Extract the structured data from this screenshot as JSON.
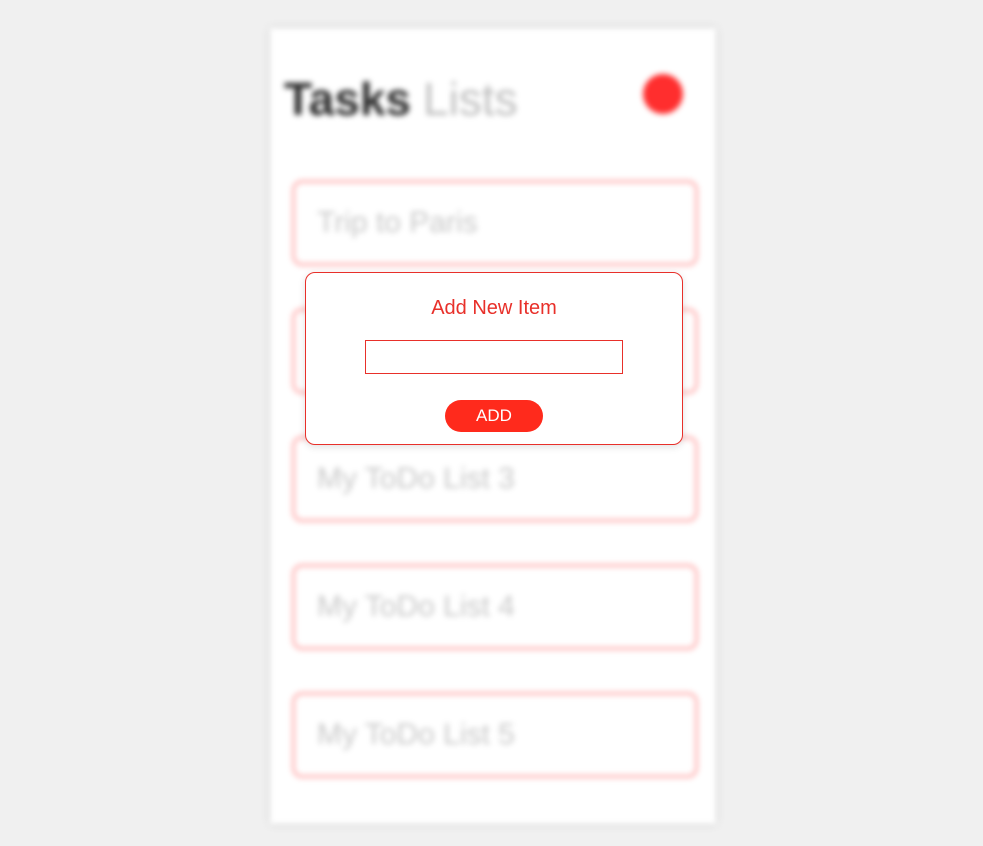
{
  "app": {
    "title_strong": "Tasks",
    "title_light": "Lists"
  },
  "lists": [
    {
      "label": "Trip to Paris"
    },
    {
      "label": ""
    },
    {
      "label": "My ToDo List 3"
    },
    {
      "label": "My ToDo List 4"
    },
    {
      "label": "My ToDo List 5"
    }
  ],
  "modal": {
    "title": "Add New Item",
    "input_value": "",
    "button_label": "ADD"
  },
  "colors": {
    "accent": "#ff2a1c",
    "border": "#e8302a",
    "background": "#f0f0f0"
  },
  "icons": {
    "fab": "add-circle-icon"
  }
}
